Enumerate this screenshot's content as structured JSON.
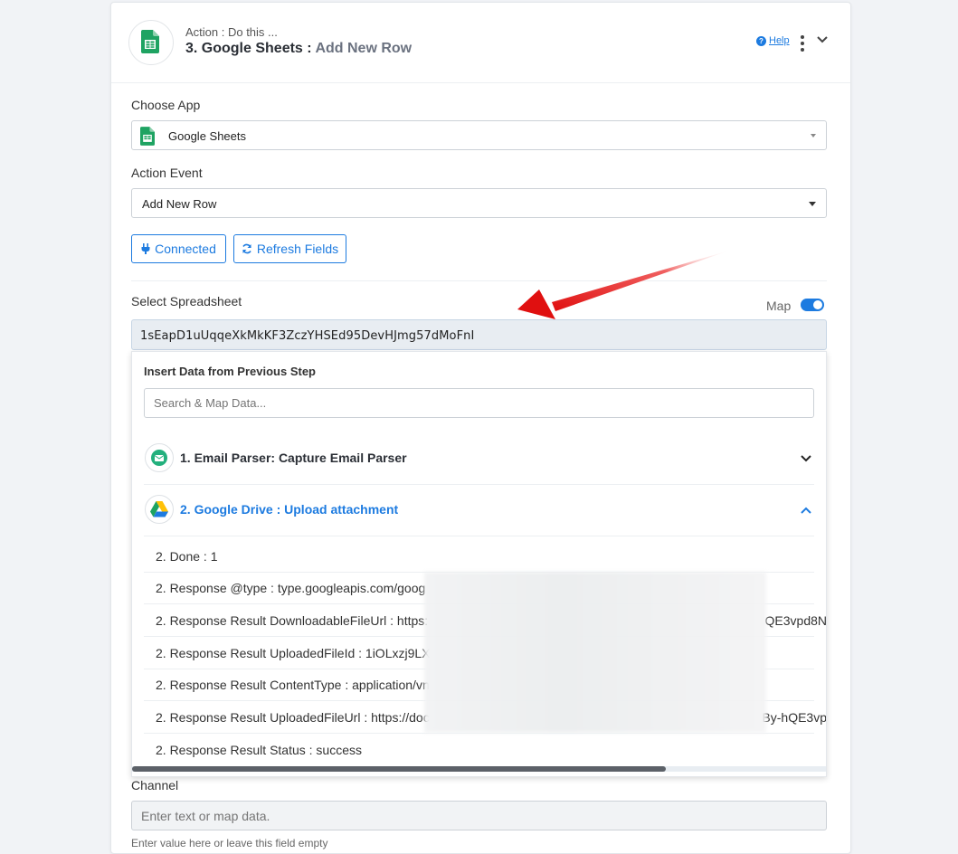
{
  "header": {
    "subtitle": "Action : Do this ...",
    "title": "3. Google Sheets :",
    "event": "Add New Row",
    "help_label": "Help"
  },
  "choose_app": {
    "label": "Choose App",
    "value": "Google Sheets"
  },
  "action_event": {
    "label": "Action Event",
    "value": "Add New Row"
  },
  "buttons": {
    "connected": "Connected",
    "refresh": "Refresh Fields"
  },
  "spreadsheet": {
    "label": "Select Spreadsheet",
    "map_label": "Map",
    "map_enabled": true,
    "value": "1sEapD1uUqqeXkMkKF3ZczYHSEd95DevHJmg57dMoFnI"
  },
  "insert_panel": {
    "title": "Insert Data from Previous Step",
    "search_placeholder": "Search & Map Data...",
    "steps": [
      {
        "label": "1. Email Parser: Capture Email Parser",
        "expanded": false
      },
      {
        "label": "2. Google Drive : Upload attachment",
        "expanded": true
      }
    ],
    "rows": [
      {
        "text": "2. Done : 1",
        "tail": ""
      },
      {
        "text": "2. Response @type : type.googleapis.com/goog",
        "tail": ""
      },
      {
        "text": "2. Response Result DownloadableFileUrl : https:",
        "tail": "QE3vpd8N"
      },
      {
        "text": "2. Response Result UploadedFileId : 1iOLxzj9LX",
        "tail": ""
      },
      {
        "text": "2. Response Result ContentType : application/vn",
        "tail": ""
      },
      {
        "text": "2. Response Result UploadedFileUrl : https://doc",
        "tail": "By-hQE3vp"
      },
      {
        "text": "2. Response Result Status : success",
        "tail": ""
      }
    ]
  },
  "channel": {
    "label": "Channel",
    "placeholder": "Enter text or map data.",
    "hint": "Enter value here or leave this field empty"
  },
  "colors": {
    "accent": "#1d7be0",
    "sheets_green": "#1ea362",
    "arrow_red": "#e01010"
  }
}
